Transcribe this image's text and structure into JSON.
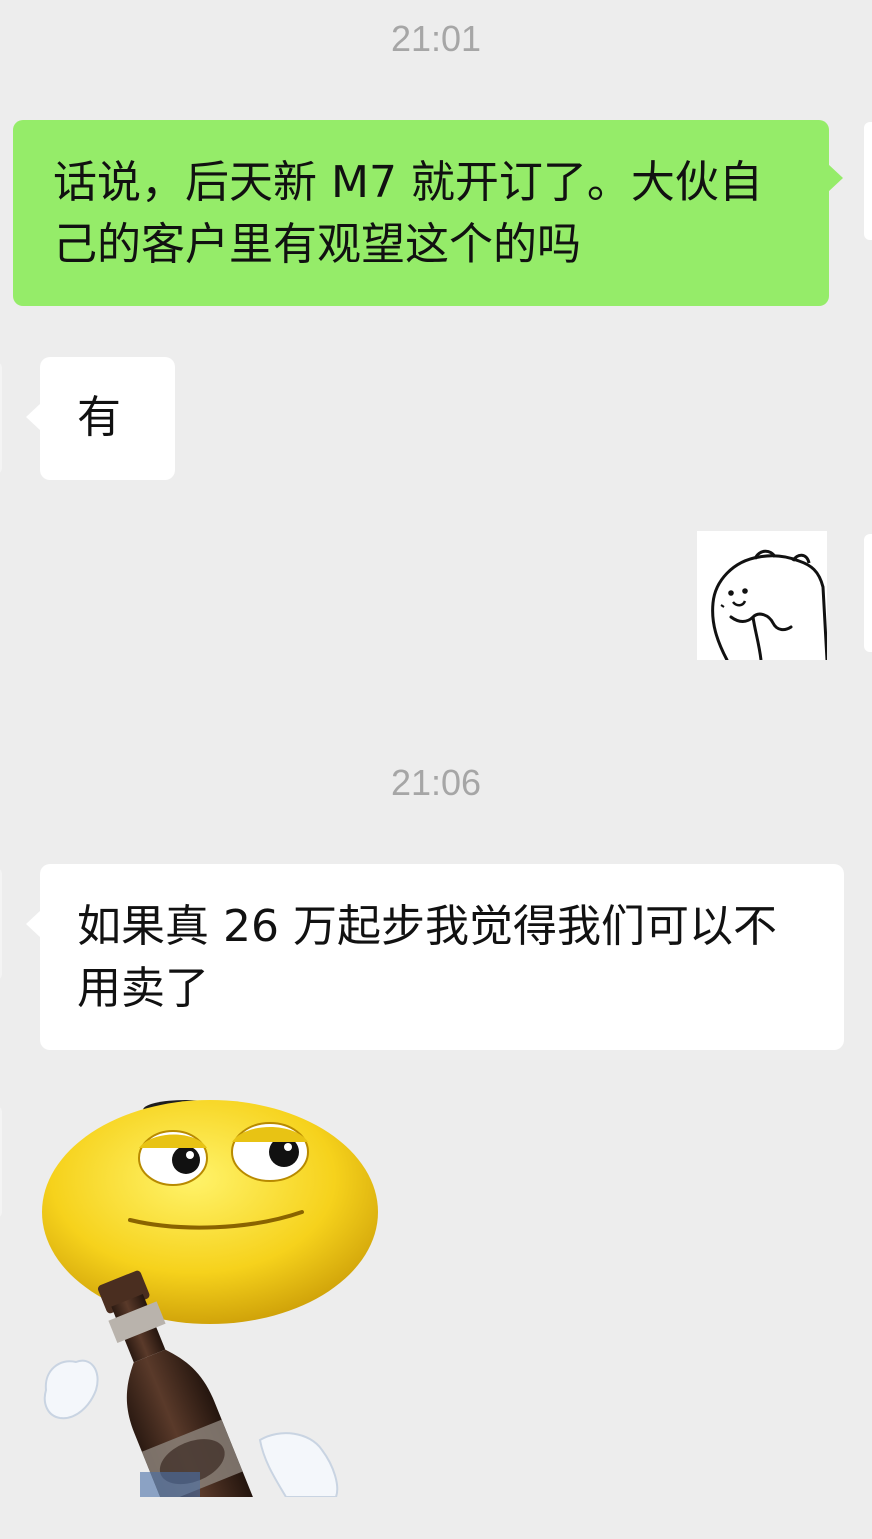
{
  "messages": [
    {
      "type": "timestamp",
      "text": "21:01"
    },
    {
      "type": "text",
      "side": "out",
      "text": "话说，后天新 M7 就开订了。大伙自己的客户里有观望这个的吗"
    },
    {
      "type": "text",
      "side": "in",
      "text": "有"
    },
    {
      "type": "sticker",
      "side": "out",
      "name": "bear-doodle-sticker"
    },
    {
      "type": "timestamp",
      "text": "21:06"
    },
    {
      "type": "text",
      "side": "in",
      "text": "如果真 26 万起步我觉得我们可以不用卖了"
    },
    {
      "type": "sticker",
      "side": "in",
      "name": "emoji-beer-sticker"
    }
  ],
  "colors": {
    "background": "#ededed",
    "outgoing_bubble": "#95ec69",
    "incoming_bubble": "#ffffff",
    "timestamp_text": "#a6a6a6"
  }
}
